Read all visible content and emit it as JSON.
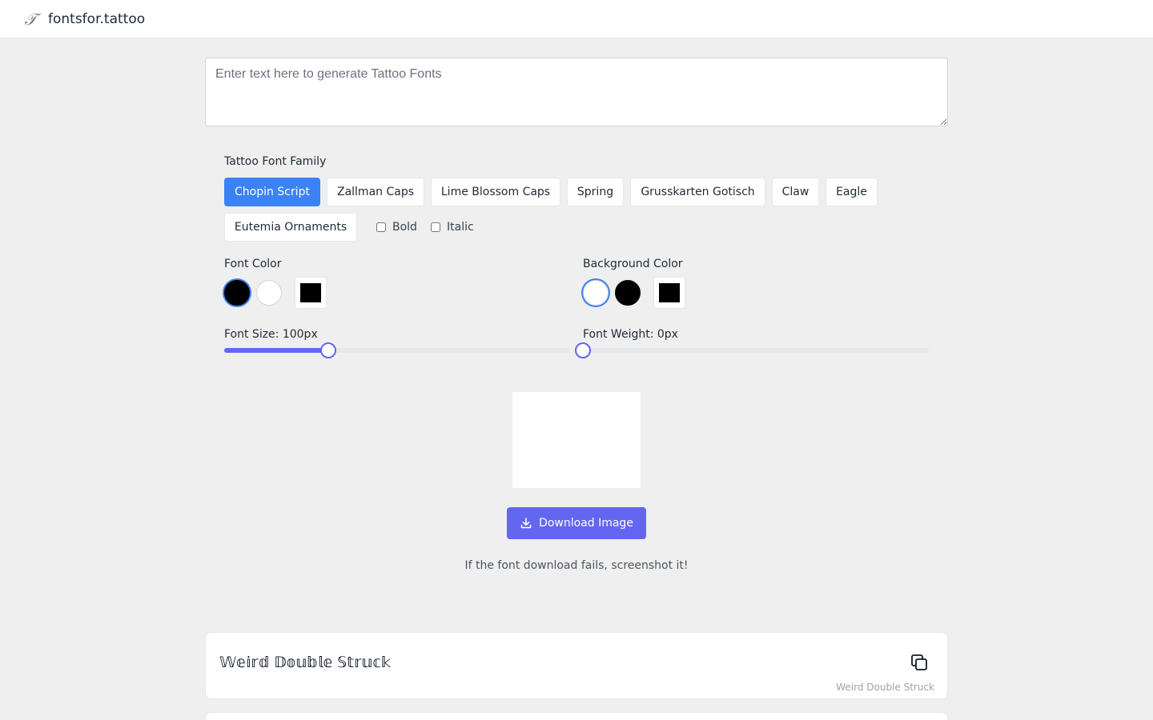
{
  "header": {
    "logo_glyph": "𝒯",
    "site_name": "fontsfor.tattoo"
  },
  "input": {
    "placeholder": "Enter text here to generate Tattoo Fonts",
    "value": ""
  },
  "font_family": {
    "label": "Tattoo Font Family",
    "options": [
      {
        "label": "Chopin Script",
        "active": true
      },
      {
        "label": "Zallman Caps",
        "active": false
      },
      {
        "label": "Lime Blossom Caps",
        "active": false
      },
      {
        "label": "Spring",
        "active": false
      },
      {
        "label": "Grusskarten Gotisch",
        "active": false
      },
      {
        "label": "Claw",
        "active": false
      },
      {
        "label": "Eagle",
        "active": false
      },
      {
        "label": "Eutemia Ornaments",
        "active": false
      }
    ],
    "bold_label": "Bold",
    "bold_checked": false,
    "italic_label": "Italic",
    "italic_checked": false
  },
  "font_color": {
    "label": "Font Color",
    "swatches": [
      "#000000",
      "#ffffff"
    ],
    "selected": "#000000",
    "custom": "#000000"
  },
  "background_color": {
    "label": "Background Color",
    "swatches": [
      "#ffffff",
      "#000000"
    ],
    "selected": "#ffffff",
    "custom": "#000000"
  },
  "font_size": {
    "label": "Font Size: 100px",
    "value": 100,
    "fraction": 0.3
  },
  "font_weight": {
    "label": "Font Weight: 0px",
    "value": 0,
    "fraction": 0.0
  },
  "download": {
    "label": "Download Image"
  },
  "fail_note": "If the font download fails, screenshot it!",
  "results": [
    {
      "text": "𝕎𝕖𝕚𝕣𝕕 𝔻𝕠𝕦𝕓𝕝𝕖 𝕊𝕥𝕣𝕦𝕔𝕜",
      "style_name": "Weird Double Struck"
    },
    {
      "text": "",
      "style_name": ""
    }
  ],
  "colors": {
    "accent": "#6366f1",
    "active_button": "#3b82f6",
    "page_bg": "#efefef"
  }
}
